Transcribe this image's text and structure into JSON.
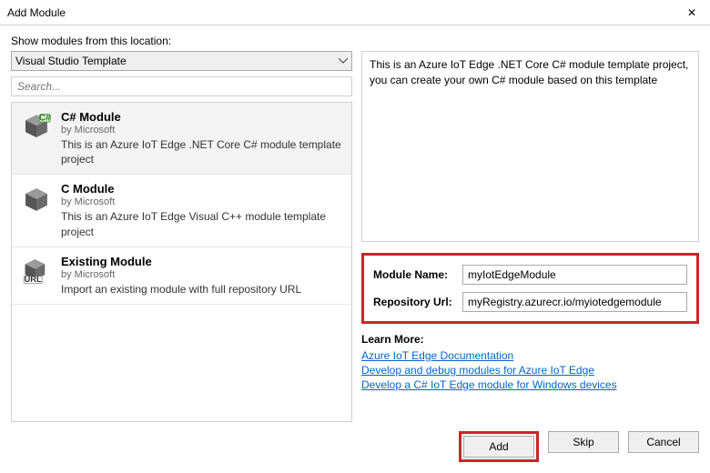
{
  "window": {
    "title": "Add Module"
  },
  "left": {
    "location_label": "Show modules from this location:",
    "location_selected": "Visual Studio Template",
    "search_placeholder": "Search...",
    "modules": [
      {
        "title": "C# Module",
        "author": "by Microsoft",
        "desc": "This is an Azure IoT Edge .NET Core C# module template project",
        "icon": "cube-cs"
      },
      {
        "title": "C Module",
        "author": "by Microsoft",
        "desc": "This is an Azure IoT Edge Visual C++ module template project",
        "icon": "cube"
      },
      {
        "title": "Existing Module",
        "author": "by Microsoft",
        "desc": "Import an existing module with full repository URL",
        "icon": "cube-url"
      }
    ]
  },
  "right": {
    "description": "This is an Azure IoT Edge .NET Core C# module template project, you can create your own C# module based on this template",
    "module_name_label": "Module Name:",
    "module_name_value": "myIotEdgeModule",
    "repository_url_label": "Repository Url:",
    "repository_url_value": "myRegistry.azurecr.io/myiotedgemodule",
    "learn_more_title": "Learn More:",
    "links": [
      "Azure IoT Edge Documentation",
      "Develop and debug modules for Azure IoT Edge",
      "Develop a C# IoT Edge module for Windows devices"
    ]
  },
  "buttons": {
    "add": "Add",
    "skip": "Skip",
    "cancel": "Cancel"
  }
}
